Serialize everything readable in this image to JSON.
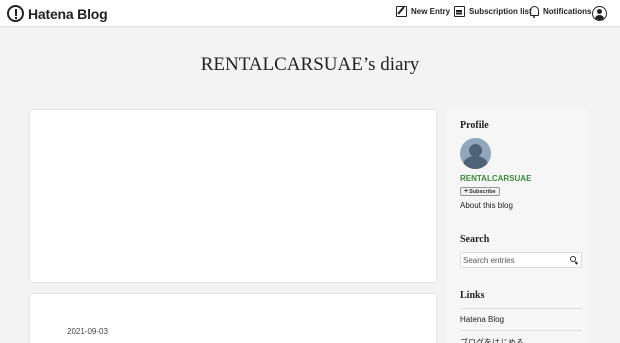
{
  "header": {
    "brand": "Hatena Blog",
    "nav": {
      "new_entry": "New Entry",
      "subscription_list": "Subscription list",
      "notifications": "Notifications"
    }
  },
  "blog": {
    "title": "RENTALCARSUAE’s diary"
  },
  "entry": {
    "date": "2021-09-03"
  },
  "sidebar": {
    "profile": {
      "heading": "Profile",
      "username": "RENTALCARSUAE",
      "subscribe_label": "Subscribe",
      "about_label": "About this blog"
    },
    "search": {
      "heading": "Search",
      "placeholder": "Search entries"
    },
    "links": {
      "heading": "Links",
      "items": [
        "Hatena Blog",
        "ブログをはじめる"
      ]
    }
  },
  "icons": {
    "brand": "hatena-logo-icon",
    "new_entry": "pencil-icon",
    "subscription": "subscription-icon",
    "notifications": "bell-icon",
    "user": "user-icon",
    "search": "search-icon"
  }
}
